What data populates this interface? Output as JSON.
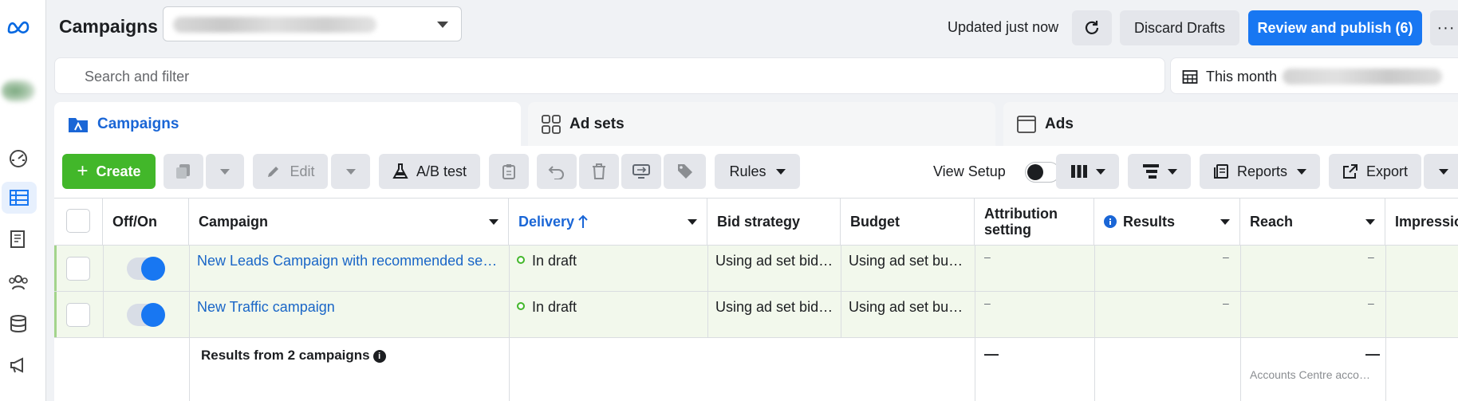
{
  "header": {
    "title": "Campaigns",
    "updated": "Updated just now",
    "discard": "Discard Drafts",
    "publish": "Review and publish (6)",
    "more": "···"
  },
  "search": {
    "placeholder": "Search and filter"
  },
  "daterange": {
    "label": "This month"
  },
  "tabs": [
    {
      "label": "Campaigns"
    },
    {
      "label": "Ad sets"
    },
    {
      "label": "Ads"
    }
  ],
  "toolbar": {
    "create": "Create",
    "edit": "Edit",
    "ab_test": "A/B test",
    "rules": "Rules",
    "view_setup": "View Setup",
    "reports": "Reports",
    "export": "Export"
  },
  "table": {
    "columns": {
      "onoff": "Off/On",
      "campaign": "Campaign",
      "delivery": "Delivery",
      "bid": "Bid strategy",
      "budget": "Budget",
      "attribution": "Attribution setting",
      "results": "Results",
      "reach": "Reach",
      "impressions": "Impressio"
    },
    "rows": [
      {
        "campaign": "New Leads Campaign with recommended setti…",
        "delivery": "In draft",
        "bid": "Using ad set bid …",
        "budget": "Using ad set bud…",
        "attribution": "–",
        "results": "–",
        "reach": "–"
      },
      {
        "campaign": "New Traffic campaign",
        "delivery": "In draft",
        "bid": "Using ad set bid …",
        "budget": "Using ad set bud…",
        "attribution": "–",
        "results": "–",
        "reach": "–"
      }
    ],
    "summary": {
      "label": "Results from 2 campaigns",
      "attribution": "—",
      "reach": "—",
      "reach_note": "Accounts Centre acco…"
    }
  },
  "colors": {
    "accent": "#1877f2",
    "create": "#42b72a",
    "draft_row": "#f2f8ec"
  }
}
